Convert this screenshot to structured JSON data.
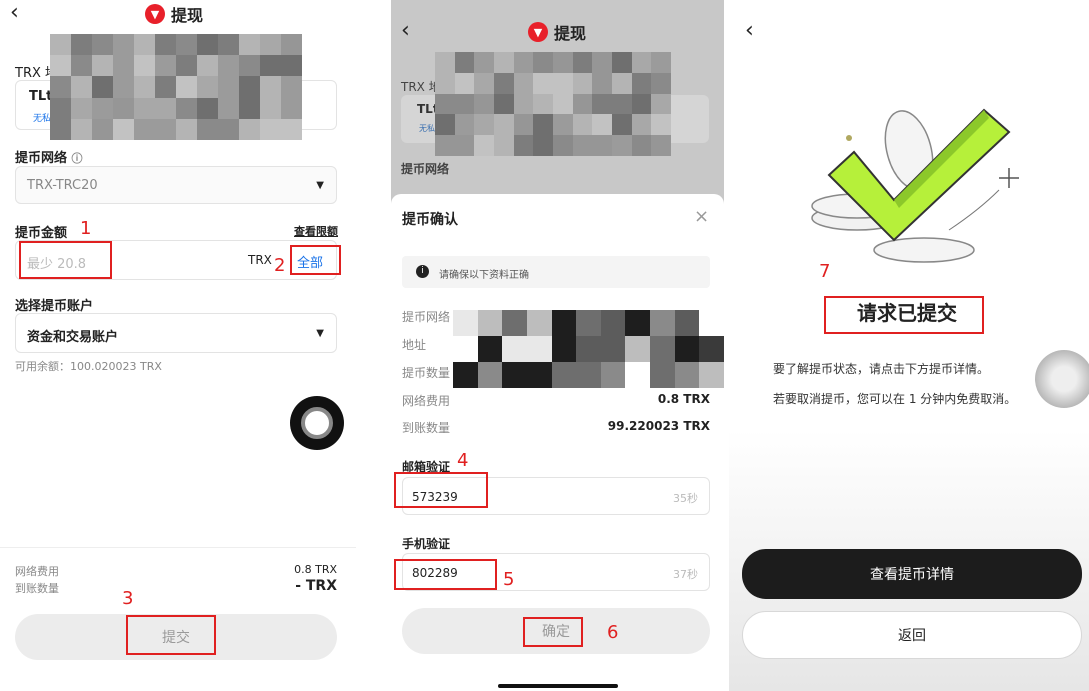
{
  "panel1": {
    "back_icon": "back-arrow-icon",
    "title": "提现",
    "trx_label": "TRX 地",
    "address_prefix": "TLt",
    "address_tag": "无私",
    "network_label": "提币网络",
    "network_value": "TRX-TRC20",
    "amount_label": "提币金额",
    "limit_link": "查看限额",
    "amount_placeholder": "最少 20.8",
    "currency": "TRX",
    "all_button": "全部",
    "account_label": "选择提币账户",
    "account_value": "资金和交易账户",
    "available": "可用余额：100.020023 TRX",
    "fee_label": "网络费用",
    "fee_value": "0.8 TRX",
    "arrive_label": "到账数量",
    "arrive_value": "- TRX",
    "submit": "提交"
  },
  "panel2": {
    "back_icon": "back-arrow-icon",
    "title": "提现",
    "bg_trx_label": "TRX 地",
    "bg_address_prefix": "TLt",
    "bg_address_tag": "无私",
    "bg_network_label": "提币网络",
    "sheet_title": "提币确认",
    "notice": "请确保以下资料正确",
    "rows": {
      "network": "提币网络",
      "address": "地址",
      "amount": "提币数量",
      "fee_label": "网络费用",
      "fee_value": "0.8 TRX",
      "arrive_label": "到账数量",
      "arrive_value": "99.220023 TRX"
    },
    "email_label": "邮箱验证",
    "email_code": "573239",
    "email_timer": "35秒",
    "phone_label": "手机验证",
    "phone_code": "802289",
    "phone_timer": "37秒",
    "confirm": "确定"
  },
  "panel3": {
    "back_icon": "back-arrow-icon",
    "heading": "请求已提交",
    "line1": "要了解提币状态，请点击下方提币详情。",
    "line2": "若要取消提币，您可以在 1 分钟内免费取消。",
    "view_details": "查看提币详情",
    "return": "返回"
  },
  "annotations": [
    "1",
    "2",
    "3",
    "4",
    "5",
    "6",
    "7"
  ],
  "colors": {
    "accent_red": "#e02020",
    "tron_red": "#e8202a",
    "check_green": "#b6f03a",
    "dark_button": "#1c1c1c",
    "link_blue": "#1a73e8"
  }
}
